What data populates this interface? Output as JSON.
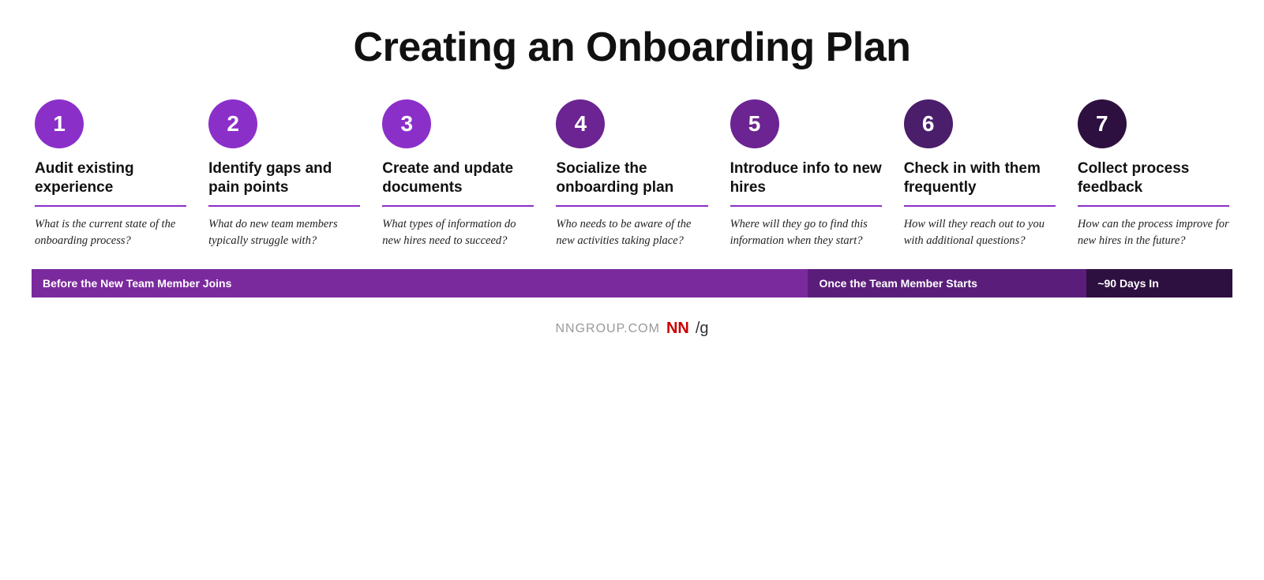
{
  "title": "Creating an Onboarding Plan",
  "steps": [
    {
      "number": "1",
      "circle_class": "circle-light",
      "title": "Audit existing experience",
      "question": "What is the current state of the onboarding process?"
    },
    {
      "number": "2",
      "circle_class": "circle-light",
      "title": "Identify gaps and pain points",
      "question": "What do new team members typically struggle with?"
    },
    {
      "number": "3",
      "circle_class": "circle-light",
      "title": "Create and update documents",
      "question": "What types of information do new hires need to succeed?"
    },
    {
      "number": "4",
      "circle_class": "circle-medium",
      "title": "Socialize the onboarding plan",
      "question": "Who needs to be aware of the new activities taking place?"
    },
    {
      "number": "5",
      "circle_class": "circle-medium",
      "title": "Introduce info to new hires",
      "question": "Where will they go to find this information when they start?"
    },
    {
      "number": "6",
      "circle_class": "circle-dark",
      "title": "Check in with them frequently",
      "question": "How will they reach out to you with additional questions?"
    },
    {
      "number": "7",
      "circle_class": "circle-darkest",
      "title": "Collect process feedback",
      "question": "How can the process improve for new hires in the future?"
    }
  ],
  "timeline": [
    {
      "label": "Before the New Team Member Joins",
      "color_class": "tl-purple",
      "flex": 5
    },
    {
      "label": "Once the Team Member Starts",
      "color_class": "tl-dark-purple",
      "flex": 1.5
    },
    {
      "label": "~90 Days In",
      "color_class": "tl-darkest",
      "flex": 0.7
    }
  ],
  "footer": {
    "nngroup_label": "NNGROUP.COM",
    "nn_label": "NN",
    "slash_g_label": "/g"
  }
}
